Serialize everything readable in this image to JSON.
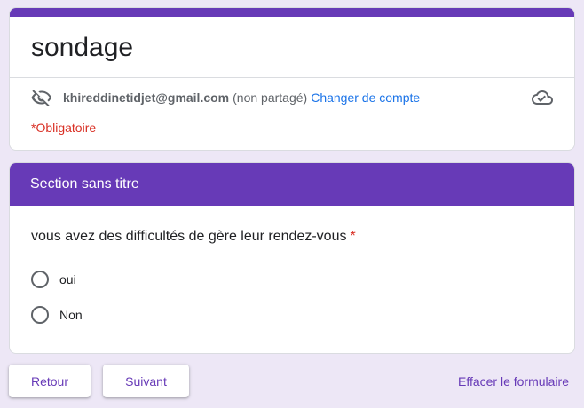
{
  "form": {
    "title": "sondage",
    "account_email": "khireddinetidjet@gmail.com",
    "account_note": "(non partagé)",
    "change_account_label": "Changer de compte",
    "required_note": "*Obligatoire"
  },
  "section": {
    "title": "Section sans titre",
    "question": "vous avez des difficultés de gère leur rendez-vous",
    "required_marker": "*",
    "options": [
      {
        "label": "oui",
        "selected": false
      },
      {
        "label": "Non",
        "selected": false
      }
    ]
  },
  "footer": {
    "back_label": "Retour",
    "next_label": "Suivant",
    "clear_label": "Effacer le formulaire"
  },
  "icons": {
    "privacy": "eye-off-icon",
    "cloud": "cloud-saved-icon"
  },
  "colors": {
    "accent": "#673ab7",
    "background": "#ede7f6",
    "required": "#d93025",
    "link": "#1a73e8"
  }
}
